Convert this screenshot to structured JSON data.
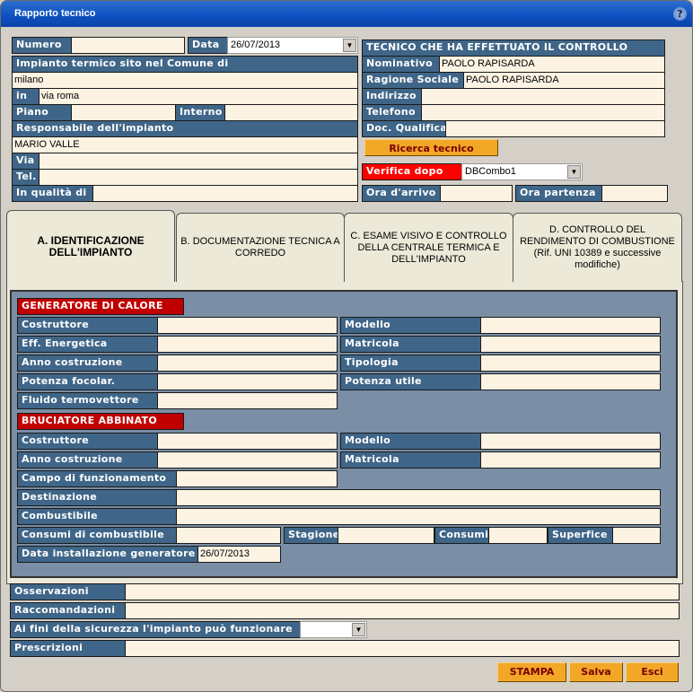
{
  "window": {
    "title": "Rapporto tecnico",
    "help_label": "?"
  },
  "owner": {
    "numero_label": "Numero",
    "numero_value": "",
    "data_label": "Data",
    "data_value": "26/07/2013",
    "impianto_header": "Impianto termico sito nel Comune di",
    "comune_value": "milano",
    "in_label": "in",
    "in_value": "via roma",
    "piano_label": "Piano",
    "piano_value": "",
    "interno_label": "Interno",
    "interno_value": "",
    "responsabile_header": "Responsabile dell'impianto",
    "responsabile_value": "MARIO VALLE",
    "via_label": "Via",
    "via_value": "",
    "tel_label": "Tel.",
    "tel_value": "",
    "qualita_label": "In qualità di",
    "qualita_value": ""
  },
  "tecnico": {
    "header": "TECNICO CHE HA EFFETTUATO IL CONTROLLO",
    "nominativo_label": "Nominativo",
    "nominativo_value": "PAOLO RAPISARDA",
    "ragione_label": "Ragione Sociale",
    "ragione_value": "PAOLO RAPISARDA",
    "indirizzo_label": "Indirizzo",
    "indirizzo_value": "",
    "telefono_label": "Telefono",
    "telefono_value": "",
    "doc_label": "Doc. Qualifica",
    "doc_value": "",
    "ricerca_button": "Ricerca tecnico",
    "verifica_label": "Verifica dopo",
    "verifica_value": "DBCombo1",
    "arrivo_label": "Ora d'arrivo",
    "arrivo_value": "",
    "partenza_label": "Ora partenza",
    "partenza_value": ""
  },
  "tabs": [
    {
      "label": "A. IDENTIFICAZIONE DELL'IMPIANTO",
      "selected": true
    },
    {
      "label": "B. DOCUMENTAZIONE TECNICA A CORREDO",
      "selected": false
    },
    {
      "label": "C. ESAME VISIVO E CONTROLLO DELLA CENTRALE TERMICA E DELL'IMPIANTO",
      "selected": false
    },
    {
      "label": "D. CONTROLLO DEL RENDIMENTO DI COMBUSTIONE (Rif. UNI 10389 e successive modifiche)",
      "selected": false
    }
  ],
  "generatore": {
    "header": "GENERATORE DI CALORE",
    "costruttore_label": "Costruttore",
    "costruttore_value": "",
    "modello_label": "Modello",
    "modello_value": "",
    "eff_label": "Eff. Energetica",
    "eff_value": "",
    "matricola_label": "Matricola",
    "matricola_value": "",
    "anno_label": "Anno costruzione",
    "anno_value": "",
    "tipologia_label": "Tipologia",
    "tipologia_value": "",
    "potenza_focolare_label": "Potenza focolar.",
    "potenza_focolare_value": "",
    "potenza_utile_label": "Potenza utile",
    "potenza_utile_value": "",
    "fluido_label": "Fluido termovettore",
    "fluido_value": ""
  },
  "bruciatore": {
    "header": "BRUCIATORE ABBINATO",
    "costruttore_label": "Costruttore",
    "costruttore_value": "",
    "modello_label": "Modello",
    "modello_value": "",
    "anno_label": "Anno costruzione",
    "anno_value": "",
    "matricola_label": "Matricola",
    "matricola_value": "",
    "campo_label": "Campo di funzionamento",
    "campo_value": "",
    "destinazione_label": "Destinazione",
    "destinazione_value": "",
    "combustibile_label": "Combustibile",
    "combustibile_value": "",
    "consumi_comb_label": "Consumi di combustibile",
    "consumi_comb_value": "",
    "stagione_label": "Stagione",
    "stagione_value": "",
    "consumi_label": "Consumi",
    "consumi_value": "",
    "superfice_label": "Superfice",
    "superfice_value": "",
    "data_install_label": "Data installazione generatore",
    "data_install_value": "26/07/2013"
  },
  "bottom": {
    "osservazioni_label": "Osservazioni",
    "osservazioni_value": "",
    "raccomandazioni_label": "Raccomandazioni",
    "raccomandazioni_value": "",
    "sicurezza_label": "Ai fini della sicurezza l'impianto può funzionare",
    "sicurezza_value": "",
    "prescrizioni_label": "Prescrizioni",
    "prescrizioni_value": "",
    "stampa_button": "STAMPA",
    "salva_button": "Salva",
    "esci_button": "Esci"
  },
  "colors": {
    "label_bg": "#3f6688",
    "field_bg": "#fdf3e3",
    "section_red": "#c00000",
    "button_orange": "#f2a727"
  }
}
